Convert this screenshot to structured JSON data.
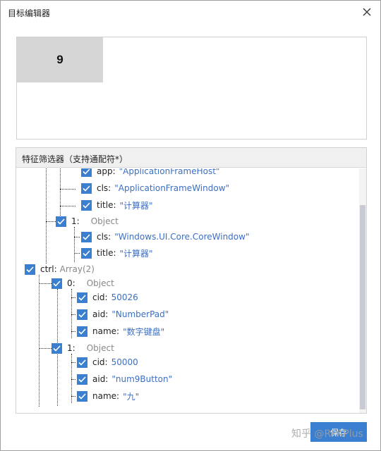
{
  "window": {
    "title": "目标编辑器",
    "close_glyph": "✕"
  },
  "preview": {
    "tile_text": "9"
  },
  "filter": {
    "header": "特征筛选器（支持通配符*）",
    "rows": [
      {
        "key": "app:",
        "value": "\"ApplicationFrameHost\"",
        "type": ""
      },
      {
        "key": "cls:",
        "value": "\"ApplicationFrameWindow\"",
        "type": ""
      },
      {
        "key": "title:",
        "value": "\"计算器\"",
        "type": ""
      },
      {
        "key": "1:",
        "value": "",
        "type": "Object"
      },
      {
        "key": "cls:",
        "value": "\"Windows.UI.Core.CoreWindow\"",
        "type": ""
      },
      {
        "key": "title:",
        "value": "\"计算器\"",
        "type": ""
      },
      {
        "key": "ctrl:",
        "value": "",
        "type": "Array(2)"
      },
      {
        "key": "0:",
        "value": "",
        "type": "Object"
      },
      {
        "key": "cid:",
        "value": "50026",
        "type": ""
      },
      {
        "key": "aid:",
        "value": "\"NumberPad\"",
        "type": ""
      },
      {
        "key": "name:",
        "value": "\"数字键盘\"",
        "type": ""
      },
      {
        "key": "1:",
        "value": "",
        "type": "Object"
      },
      {
        "key": "cid:",
        "value": "50000",
        "type": ""
      },
      {
        "key": "aid:",
        "value": "\"num9Button\"",
        "type": ""
      },
      {
        "key": "name:",
        "value": "\"九\"",
        "type": ""
      }
    ]
  },
  "footer": {
    "save_label": "保存",
    "watermark": "知乎 @RPAPlus"
  },
  "colors": {
    "accent": "#3a7fd0",
    "value_text": "#3b6fc4",
    "tile_bg": "#d6d6d6",
    "scroll_thumb": "#c8cbd4"
  },
  "icons": {
    "close": "close-icon",
    "checkbox": "checkmark-icon"
  }
}
